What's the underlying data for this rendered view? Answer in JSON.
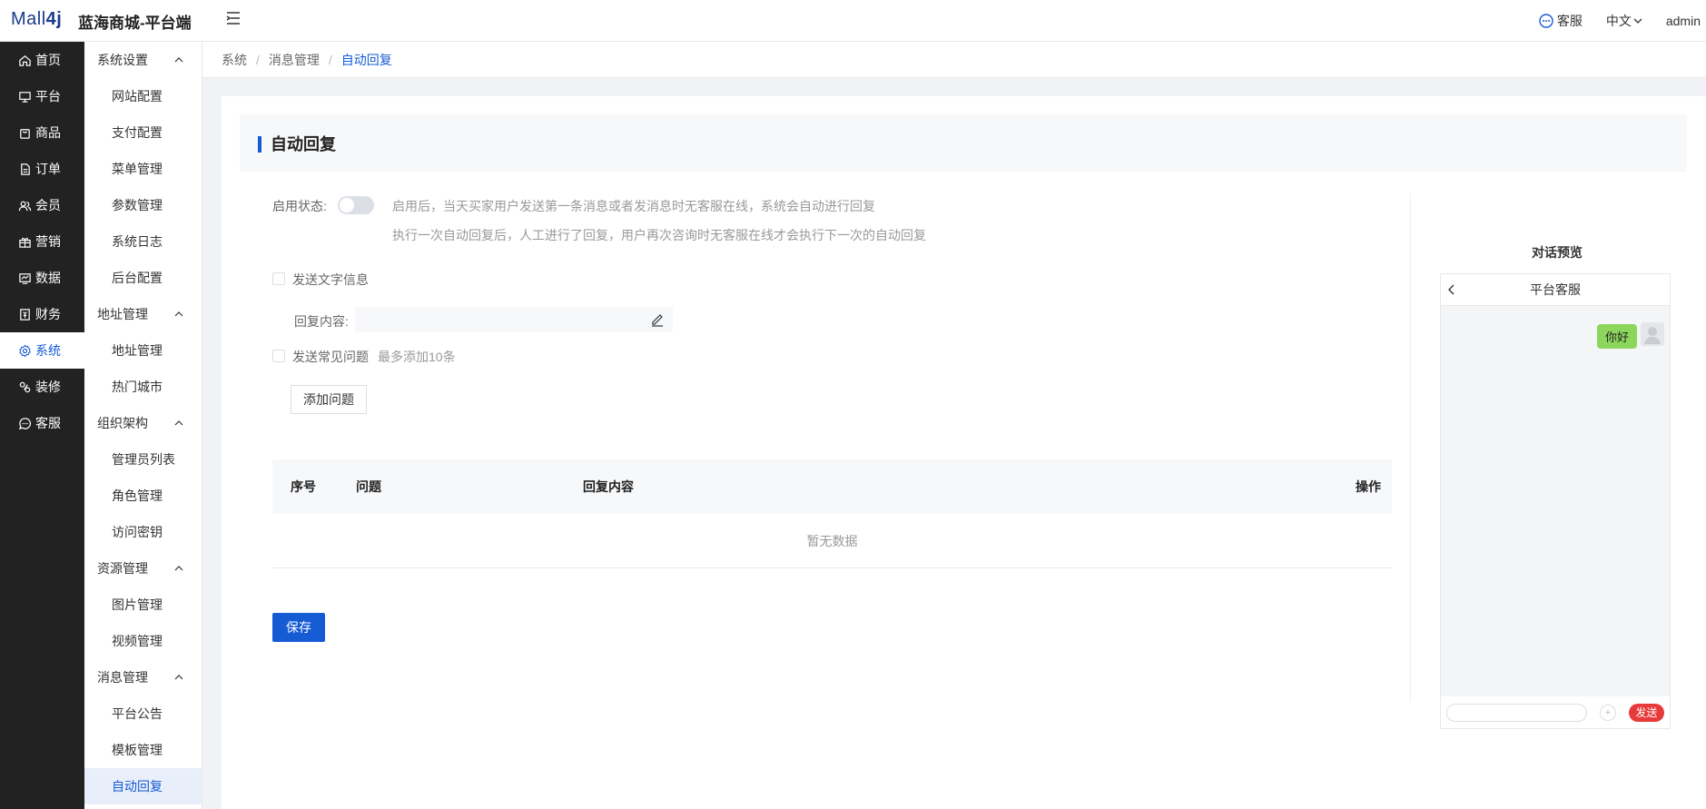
{
  "header": {
    "logo_prefix": "Mall",
    "logo_suffix": "4j",
    "brand": "蓝海商城-平台端",
    "service": "客服",
    "language": "中文",
    "user": "admin"
  },
  "left_nav": [
    {
      "label": "首页",
      "icon": "home-icon"
    },
    {
      "label": "平台",
      "icon": "monitor-icon"
    },
    {
      "label": "商品",
      "icon": "bag-icon"
    },
    {
      "label": "订单",
      "icon": "document-icon"
    },
    {
      "label": "会员",
      "icon": "users-icon"
    },
    {
      "label": "营销",
      "icon": "gift-icon"
    },
    {
      "label": "数据",
      "icon": "chart-icon"
    },
    {
      "label": "财务",
      "icon": "finance-icon"
    },
    {
      "label": "系统",
      "icon": "gear-icon",
      "active": true
    },
    {
      "label": "装修",
      "icon": "palette-icon"
    },
    {
      "label": "客服",
      "icon": "chat-icon"
    }
  ],
  "sub_nav": [
    {
      "group": "系统设置",
      "items": [
        "网站配置",
        "支付配置",
        "菜单管理",
        "参数管理",
        "系统日志",
        "后台配置"
      ]
    },
    {
      "group": "地址管理",
      "items": [
        "地址管理",
        "热门城市"
      ]
    },
    {
      "group": "组织架构",
      "items": [
        "管理员列表",
        "角色管理",
        "访问密钥"
      ]
    },
    {
      "group": "资源管理",
      "items": [
        "图片管理",
        "视频管理"
      ]
    },
    {
      "group": "消息管理",
      "items": [
        "平台公告",
        "模板管理",
        "自动回复"
      ]
    }
  ],
  "breadcrumb": [
    "系统",
    "消息管理",
    "自动回复"
  ],
  "page": {
    "title": "自动回复",
    "enable_label": "启用状态:",
    "enable_hint_1": "启用后，当天买家用户发送第一条消息或者发消息时无客服在线，系统会自动进行回复",
    "enable_hint_2": "执行一次自动回复后，人工进行了回复，用户再次咨询时无客服在线才会执行下一次的自动回复",
    "send_text_label": "发送文字信息",
    "reply_label": "回复内容:",
    "reply_value": "",
    "send_faq_label": "发送常见问题",
    "faq_limit": "最多添加10条",
    "add_question": "添加问题",
    "table": {
      "headers": [
        "序号",
        "问题",
        "回复内容",
        "操作"
      ],
      "empty": "暂无数据"
    },
    "save": "保存"
  },
  "preview": {
    "title": "对话预览",
    "chat_title": "平台客服",
    "message": "你好",
    "send": "发送",
    "plus": "+"
  },
  "colors": {
    "primary": "#155bd4",
    "sidebar": "#222222",
    "bubble": "#8cd65b",
    "send": "#e83a3a"
  }
}
